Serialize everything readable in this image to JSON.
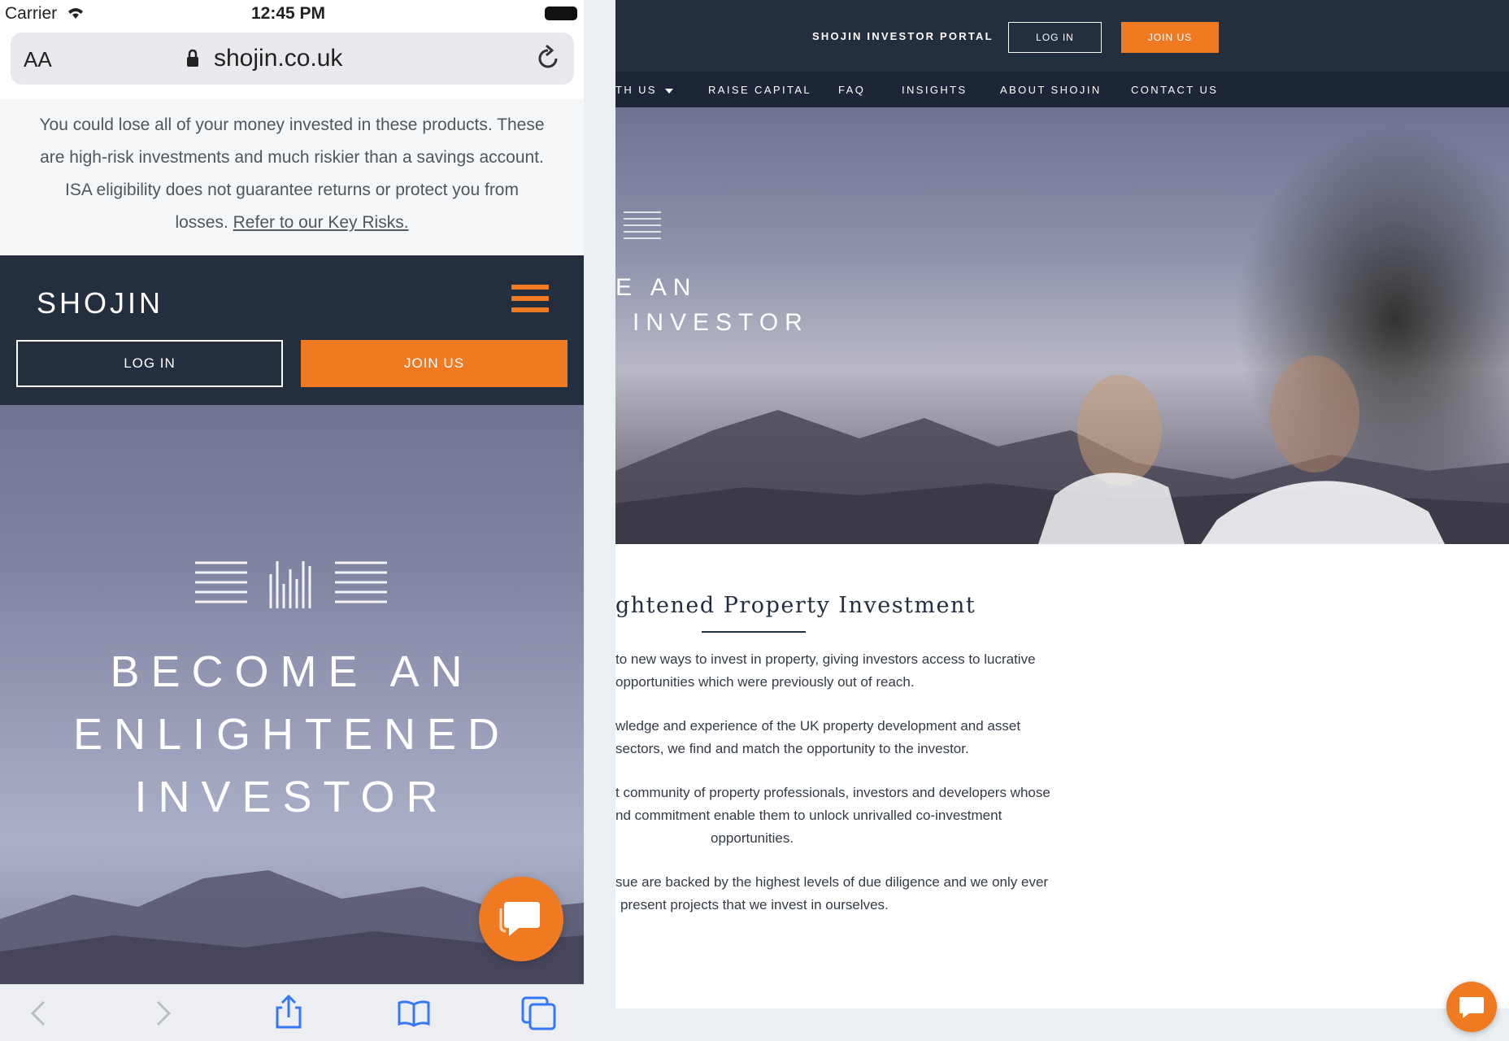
{
  "desktop": {
    "topbar": {
      "portal_label": "SHOJIN INVESTOR PORTAL",
      "login_label": "LOG IN",
      "join_label": "JOIN US"
    },
    "nav": [
      {
        "label": "TH US"
      },
      {
        "label": "RAISE CAPITAL"
      },
      {
        "label": "FAQ"
      },
      {
        "label": "INSIGHTS"
      },
      {
        "label": "ABOUT SHOJIN"
      },
      {
        "label": "CONTACT US"
      }
    ],
    "hero": {
      "line1": "E AN",
      "line2": "INVESTOR"
    },
    "content": {
      "heading": "ghtened Property Investment",
      "paragraphs": [
        {
          "line1": "to new ways to invest in property, giving investors access to lucrative",
          "line2": "opportunities which were previously out of reach."
        },
        {
          "line1": "wledge and experience of the UK property development and asset",
          "line2": "sectors, we find and match the opportunity to the investor."
        },
        {
          "line1": "t community of property professionals, investors and developers whose",
          "line2": "nd commitment enable them to unlock unrivalled co-investment",
          "line3": "opportunities."
        },
        {
          "line1": "sue are backed by the highest levels of due diligence and we only ever",
          "line2": "present projects that we invest in ourselves."
        }
      ]
    },
    "chat_icon": "chat-bubble-icon"
  },
  "phone": {
    "status": {
      "carrier": "Carrier",
      "time": "12:45 PM"
    },
    "browser": {
      "text_size_label": "AA",
      "url": "shojin.co.uk"
    },
    "warning": {
      "line1": "You could lose all of your money invested in these products. These",
      "line2": "are high-risk investments and much riskier than a savings account.",
      "line3": "ISA eligibility does not guarantee returns or protect you from",
      "line4_prefix": "losses. ",
      "link": "Refer to our Key Risks."
    },
    "header": {
      "logo": "SHOJIN",
      "login_label": "LOG IN",
      "join_label": "JOIN US"
    },
    "hero": {
      "line1": "BECOME AN",
      "line2": "ENLIGHTENED",
      "line3": "INVESTOR"
    }
  },
  "colors": {
    "navy": "#232e3f",
    "orange": "#f07a22",
    "white": "#ffffff"
  }
}
